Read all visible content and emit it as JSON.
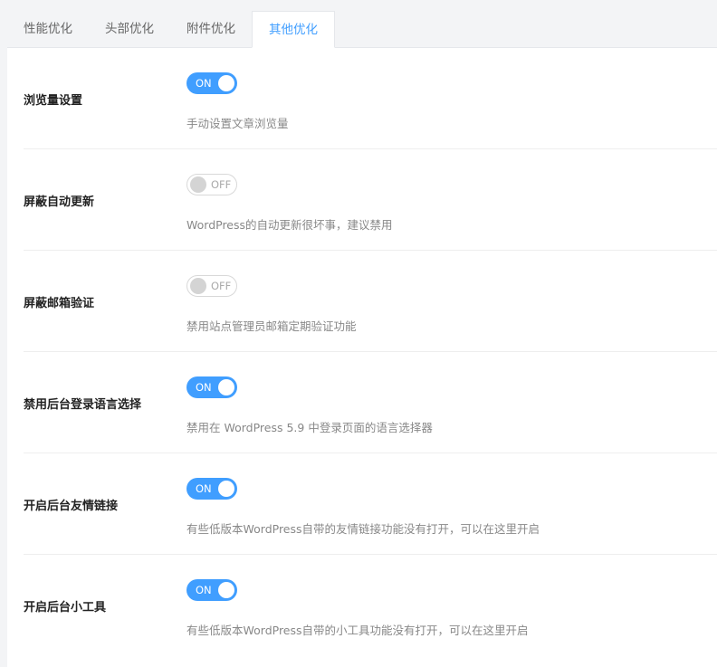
{
  "tabs": [
    {
      "label": "性能优化",
      "active": false
    },
    {
      "label": "头部优化",
      "active": false
    },
    {
      "label": "附件优化",
      "active": false
    },
    {
      "label": "其他优化",
      "active": true
    }
  ],
  "settings": [
    {
      "label": "浏览量设置",
      "state": "ON",
      "desc": "手动设置文章浏览量"
    },
    {
      "label": "屏蔽自动更新",
      "state": "OFF",
      "desc": "WordPress的自动更新很坏事，建议禁用"
    },
    {
      "label": "屏蔽邮箱验证",
      "state": "OFF",
      "desc": "禁用站点管理员邮箱定期验证功能"
    },
    {
      "label": "禁用后台登录语言选择",
      "state": "ON",
      "desc": "禁用在 WordPress 5.9 中登录页面的语言选择器"
    },
    {
      "label": "开启后台友情链接",
      "state": "ON",
      "desc": "有些低版本WordPress自带的友情链接功能没有打开，可以在这里开启"
    },
    {
      "label": "开启后台小工具",
      "state": "ON",
      "desc": "有些低版本WordPress自带的小工具功能没有打开，可以在这里开启"
    }
  ],
  "colors": {
    "accent": "#409eff",
    "off_knob": "#d4d4d4"
  }
}
